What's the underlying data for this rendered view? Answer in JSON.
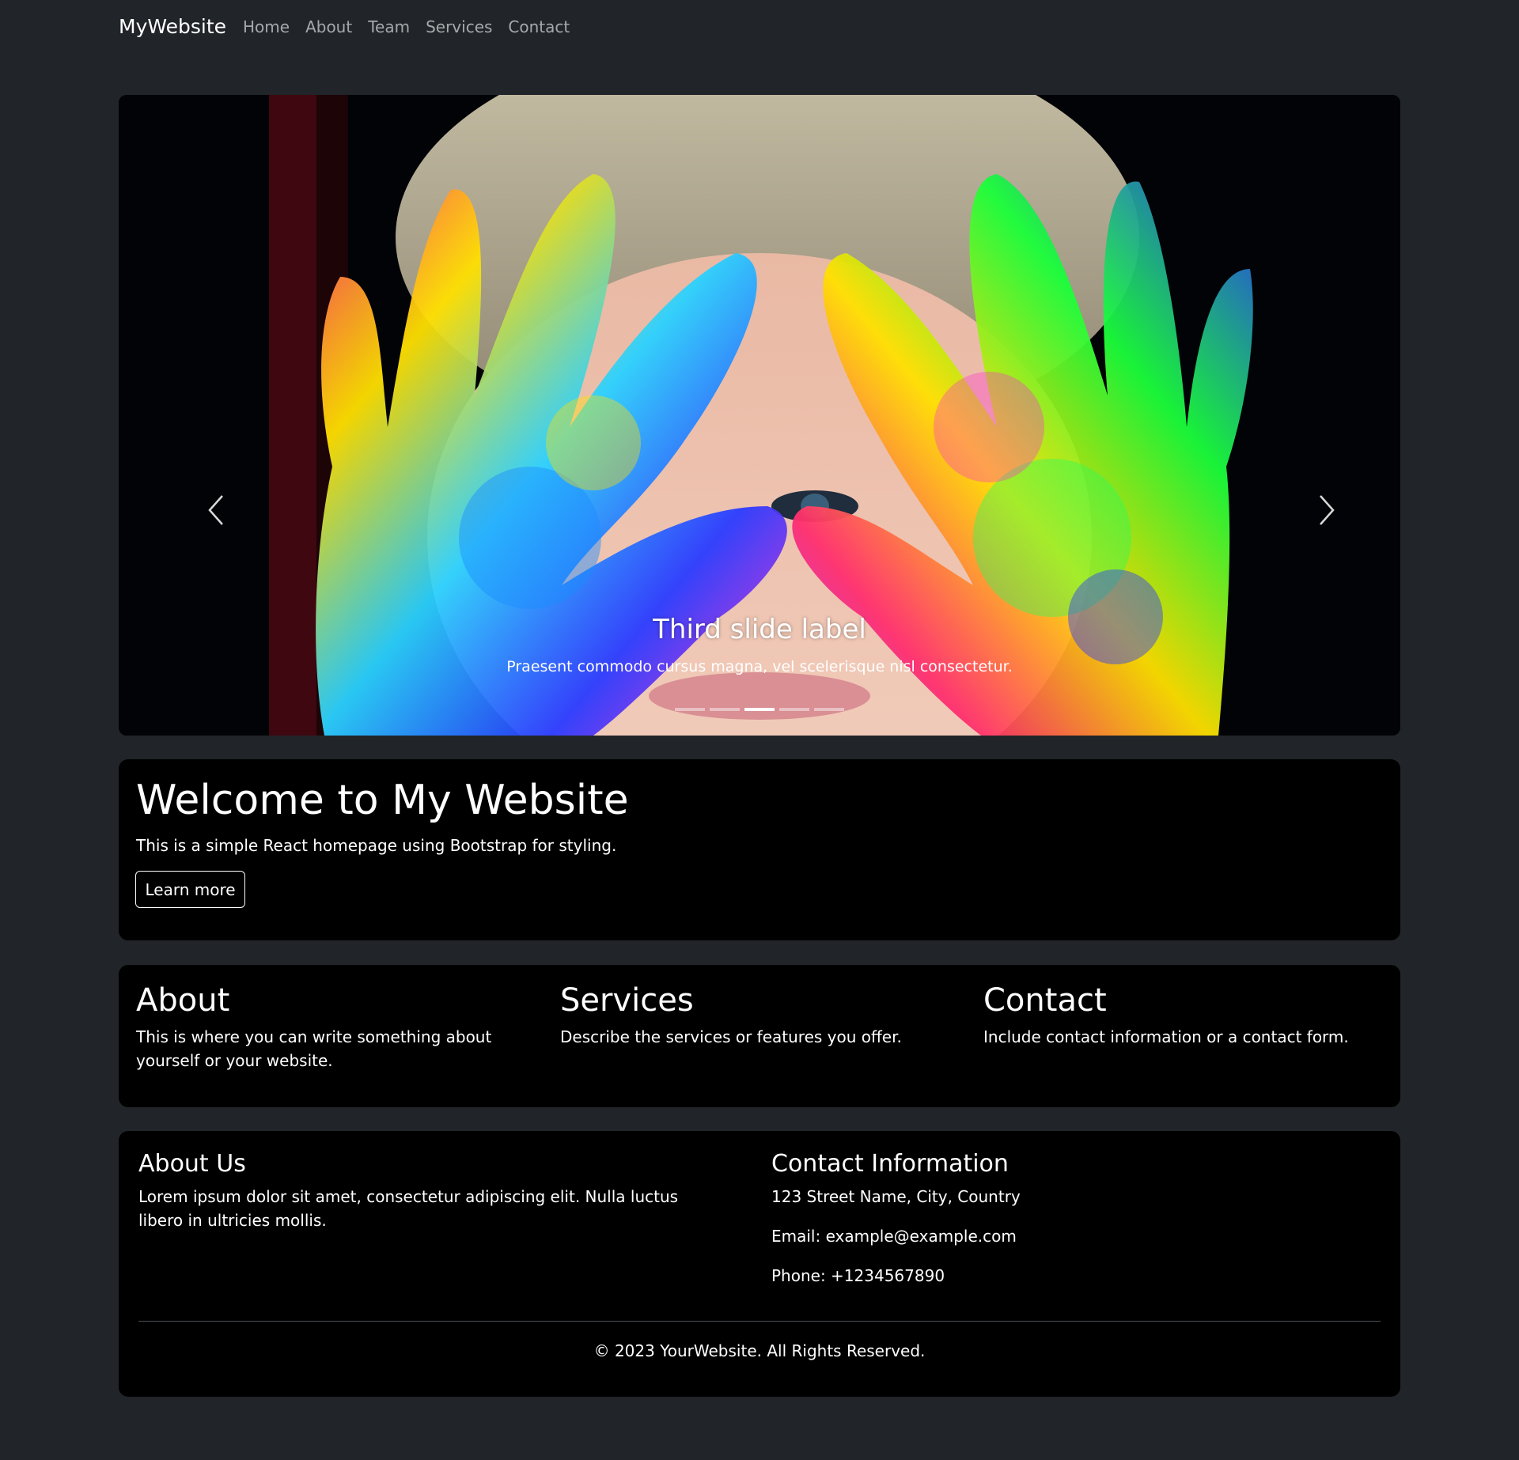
{
  "navbar": {
    "brand": "MyWebsite",
    "links": [
      "Home",
      "About",
      "Team",
      "Services",
      "Contact"
    ]
  },
  "carousel": {
    "caption_title": "Third slide label",
    "caption_text": "Praesent commodo cursus magna, vel scelerisque nisl consectetur.",
    "slide_count": 5,
    "active_index": 2,
    "prev_icon": "chevron-left-icon",
    "next_icon": "chevron-right-icon"
  },
  "welcome": {
    "title": "Welcome to My Website",
    "text": "This is a simple React homepage using Bootstrap for styling.",
    "button_label": "Learn more"
  },
  "features": [
    {
      "title": "About",
      "text": "This is where you can write something about yourself or your website."
    },
    {
      "title": "Services",
      "text": "Describe the services or features you offer."
    },
    {
      "title": "Contact",
      "text": "Include contact information or a contact form."
    }
  ],
  "footer": {
    "about_title": "About Us",
    "about_text": "Lorem ipsum dolor sit amet, consectetur adipiscing elit. Nulla luctus libero in ultricies mollis.",
    "contact_title": "Contact Information",
    "address": "123 Street Name, City, Country",
    "email": "Email: example@example.com",
    "phone": "Phone: +1234567890",
    "copyright": "© 2023 YourWebsite. All Rights Reserved."
  },
  "colors": {
    "page_background": "#212529",
    "card_background": "#000000",
    "text": "#ffffff",
    "nav_link": "#9a9da0"
  }
}
